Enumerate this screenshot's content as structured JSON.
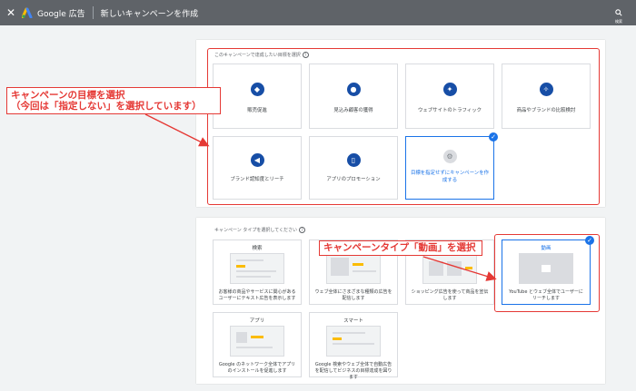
{
  "topbar": {
    "close_icon": "close-icon",
    "brand": "Google 広告",
    "title": "新しいキャンペーンを作成",
    "search_label": "検索",
    "bg_color": "#5f6368"
  },
  "goal_section": {
    "heading": "このキャンペーンで達成したい目標を選択",
    "cards": [
      {
        "label": "販売促進",
        "icon": "tag-icon"
      },
      {
        "label": "見込み顧客の獲得",
        "icon": "people-icon"
      },
      {
        "label": "ウェブサイトのトラフィック",
        "icon": "cursor-click-icon"
      },
      {
        "label": "商品やブランドの比較検討",
        "icon": "sparkle-icon"
      },
      {
        "label": "ブランド認知度とリーチ",
        "icon": "megaphone-icon"
      },
      {
        "label": "アプリのプロモーション",
        "icon": "phone-icon"
      },
      {
        "label": "目標を指定せずにキャンペーンを作成する",
        "icon": "gear-icon",
        "selected": true
      }
    ]
  },
  "type_section": {
    "heading": "キャンペーン タイプを選択してください",
    "cards": [
      {
        "name": "検索",
        "desc": "お客様の商品やサービスに関心があるユーザーにテキスト広告を表示します"
      },
      {
        "name": "",
        "desc": "ウェブ全体にさまざまな種類の広告を配信します"
      },
      {
        "name": "",
        "desc": "ショッピング広告を使って商品を宣伝します"
      },
      {
        "name": "動画",
        "desc": "YouTube とウェブ全体でユーザーにリーチします",
        "selected": true
      },
      {
        "name": "アプリ",
        "desc": "Google のネットワーク全体でアプリのインストールを促進します"
      },
      {
        "name": "スマート",
        "desc": "Google 検索やウェブ全体で自動広告を配信してビジネスの目標達成を図ります"
      }
    ]
  },
  "annotations": {
    "goal_callout_line1": "キャンペーンの目標を選択",
    "goal_callout_line2": "（今回は「指定しない」を選択しています）",
    "type_callout": "キャンペーンタイプ「動画」を選択",
    "color": "#e53935"
  },
  "accent_color": "#1a73e8"
}
